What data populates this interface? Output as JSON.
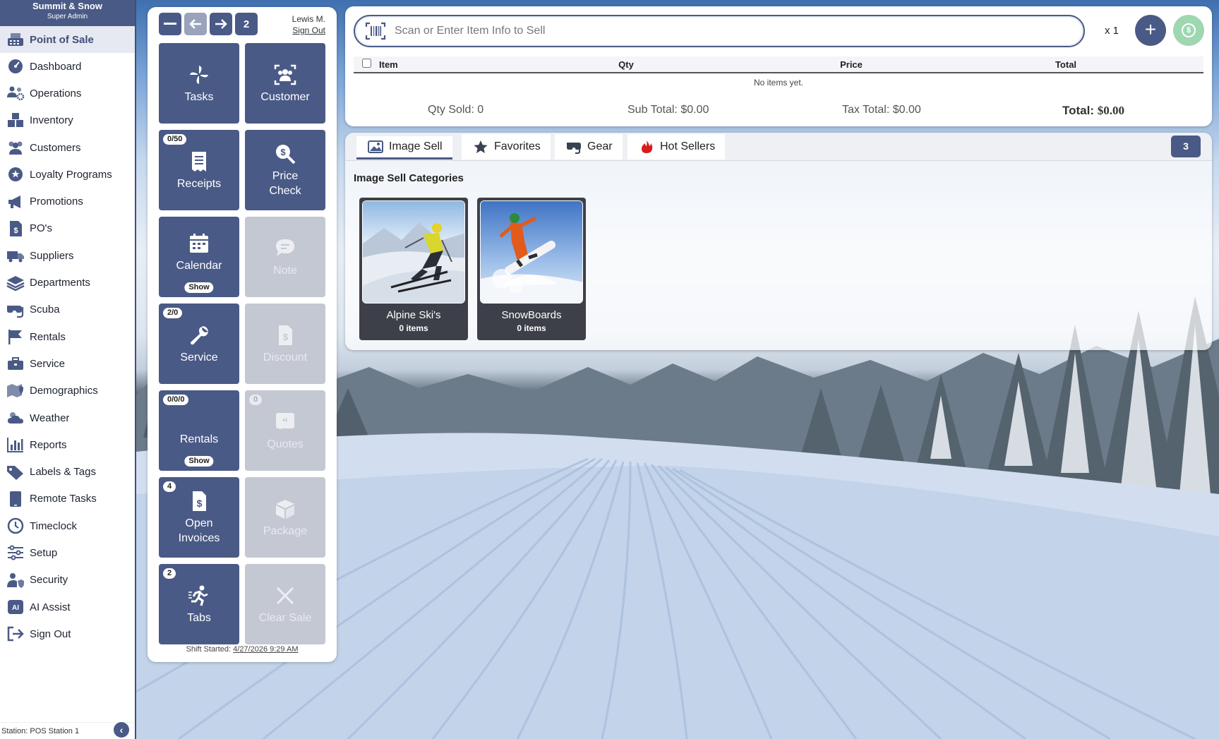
{
  "brand": {
    "name": "Summit & Snow",
    "role": "Super Admin"
  },
  "sidebar": {
    "items": [
      {
        "label": "Point of Sale",
        "icon": "register-icon",
        "active": true
      },
      {
        "label": "Dashboard",
        "icon": "gauge-icon"
      },
      {
        "label": "Operations",
        "icon": "people-gear-icon"
      },
      {
        "label": "Inventory",
        "icon": "boxes-icon"
      },
      {
        "label": "Customers",
        "icon": "users-icon"
      },
      {
        "label": "Loyalty Programs",
        "icon": "stars-badge-icon"
      },
      {
        "label": "Promotions",
        "icon": "megaphone-icon"
      },
      {
        "label": "PO's",
        "icon": "purchase-order-icon"
      },
      {
        "label": "Suppliers",
        "icon": "truck-icon"
      },
      {
        "label": "Departments",
        "icon": "layers-icon"
      },
      {
        "label": "Scuba",
        "icon": "scuba-mask-icon"
      },
      {
        "label": "Rentals",
        "icon": "flag-icon"
      },
      {
        "label": "Service",
        "icon": "toolbox-icon"
      },
      {
        "label": "Demographics",
        "icon": "map-pin-icon"
      },
      {
        "label": "Weather",
        "icon": "cloud-sun-icon"
      },
      {
        "label": "Reports",
        "icon": "bar-chart-icon"
      },
      {
        "label": "Labels & Tags",
        "icon": "tags-icon"
      },
      {
        "label": "Remote Tasks",
        "icon": "tablet-icon"
      },
      {
        "label": "Timeclock",
        "icon": "clock-icon"
      },
      {
        "label": "Setup",
        "icon": "sliders-icon"
      },
      {
        "label": "Security",
        "icon": "user-shield-icon"
      },
      {
        "label": "AI Assist",
        "icon": "ai-icon"
      },
      {
        "label": "Sign Out",
        "icon": "sign-out-icon"
      }
    ],
    "station": "Station: POS Station 1"
  },
  "action_panel": {
    "nav_count": "2",
    "user_name": "Lewis M.",
    "sign_out": "Sign Out",
    "tiles": [
      {
        "label": "Tasks",
        "icon": "pinwheel-icon",
        "enabled": true
      },
      {
        "label": "Customer",
        "icon": "customer-scan-icon",
        "enabled": true
      },
      {
        "label": "Receipts",
        "icon": "receipt-icon",
        "enabled": true,
        "badge": "0/50"
      },
      {
        "label": "Price Check",
        "icon": "price-check-icon",
        "enabled": true
      },
      {
        "label": "Calendar",
        "icon": "calendar-icon",
        "enabled": true,
        "pill": "Show"
      },
      {
        "label": "Note",
        "icon": "note-icon",
        "enabled": false
      },
      {
        "label": "Service",
        "icon": "wrench-icon",
        "enabled": true,
        "badge": "2/0"
      },
      {
        "label": "Discount",
        "icon": "discount-icon",
        "enabled": false
      },
      {
        "label": "Rentals",
        "icon": "flag-icon",
        "enabled": true,
        "badge": "0/0/0",
        "pill": "Show"
      },
      {
        "label": "Quotes",
        "icon": "quote-icon",
        "enabled": false,
        "badge": "0"
      },
      {
        "label": "Open Invoices",
        "icon": "invoice-icon",
        "enabled": true,
        "badge": "4"
      },
      {
        "label": "Package",
        "icon": "package-icon",
        "enabled": false
      },
      {
        "label": "Tabs",
        "icon": "running-icon",
        "enabled": true,
        "badge": "2"
      },
      {
        "label": "Clear Sale",
        "icon": "x-icon",
        "enabled": false
      }
    ],
    "shift_label": "Shift Started:",
    "shift_time": "4/27/2026 9:29 AM"
  },
  "sale": {
    "scan_placeholder": "Scan or Enter Item Info to Sell",
    "qty_multiplier": "x 1",
    "table_headers": {
      "item": "Item",
      "qty": "Qty",
      "price": "Price",
      "total": "Total"
    },
    "empty_message": "No items yet.",
    "totals": {
      "qty_sold": "Qty Sold:  0",
      "sub_total": "Sub Total:  $0.00",
      "tax_total": "Tax Total:  $0.00",
      "total_label": "Total:",
      "total_value": "$0.00"
    }
  },
  "catalog": {
    "tabs": [
      {
        "label": "Image Sell",
        "icon": "image-icon",
        "active": true
      },
      {
        "label": "Favorites",
        "icon": "star-icon"
      },
      {
        "label": "Gear",
        "icon": "gear-mask-icon"
      },
      {
        "label": "Hot Sellers",
        "icon": "fire-icon"
      }
    ],
    "tab_count": "3",
    "section_title": "Image Sell Categories",
    "categories": [
      {
        "name": "Alpine Ski's",
        "count": "0 items"
      },
      {
        "name": "SnowBoards",
        "count": "0 items"
      }
    ]
  },
  "colors": {
    "primary": "#4a5a86",
    "pay_green": "#9ed7b0",
    "disabled_tile": "#c4c8d2"
  }
}
